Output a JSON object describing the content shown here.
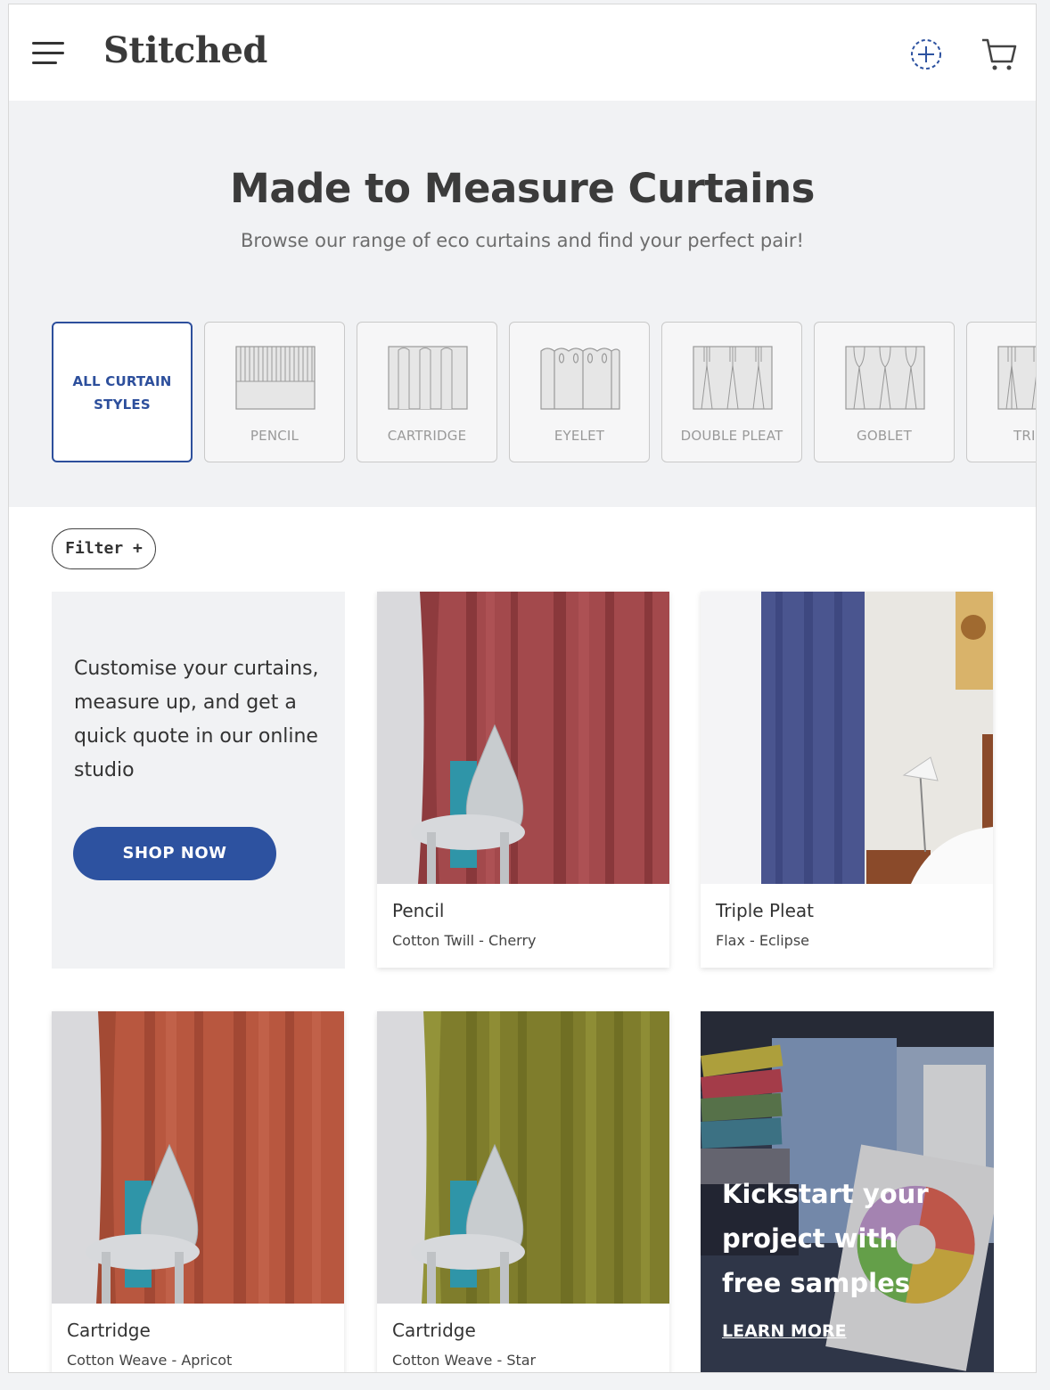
{
  "header": {
    "logo": "Stitched"
  },
  "hero": {
    "title": "Made to Measure Curtains",
    "subtitle": "Browse our range of eco curtains and find your perfect pair!"
  },
  "style_tiles": [
    {
      "label": "ALL CURTAIN STYLES",
      "icon": "none",
      "active": true
    },
    {
      "label": "PENCIL",
      "icon": "pencil-pleat-icon"
    },
    {
      "label": "CARTRIDGE",
      "icon": "cartridge-pleat-icon"
    },
    {
      "label": "EYELET",
      "icon": "eyelet-icon"
    },
    {
      "label": "DOUBLE PLEAT",
      "icon": "double-pleat-icon"
    },
    {
      "label": "GOBLET",
      "icon": "goblet-pleat-icon"
    },
    {
      "label": "TRIPLE",
      "icon": "triple-pleat-icon"
    }
  ],
  "filter": {
    "label": "Filter +"
  },
  "promo": {
    "text": "Customise your curtains, measure up, and get a quick quote in our online studio",
    "button": "SHOP NOW"
  },
  "products": [
    {
      "title": "Pencil",
      "subtitle": "Cotton Twill - Cherry",
      "color": "#a3494c"
    },
    {
      "title": "Triple Pleat",
      "subtitle": "Flax - Eclipse",
      "color": "#4a558f"
    },
    {
      "title": "Cartridge",
      "subtitle": "Cotton Weave - Apricot",
      "color": "#b8573f"
    },
    {
      "title": "Cartridge",
      "subtitle": "Cotton Weave - Star",
      "color": "#7f7d2c"
    }
  ],
  "samples": {
    "text": "Kickstart your project with free samples",
    "link": "LEARN MORE"
  },
  "colors": {
    "brand_blue": "#2d52a0",
    "hero_bg": "#f1f2f4"
  }
}
